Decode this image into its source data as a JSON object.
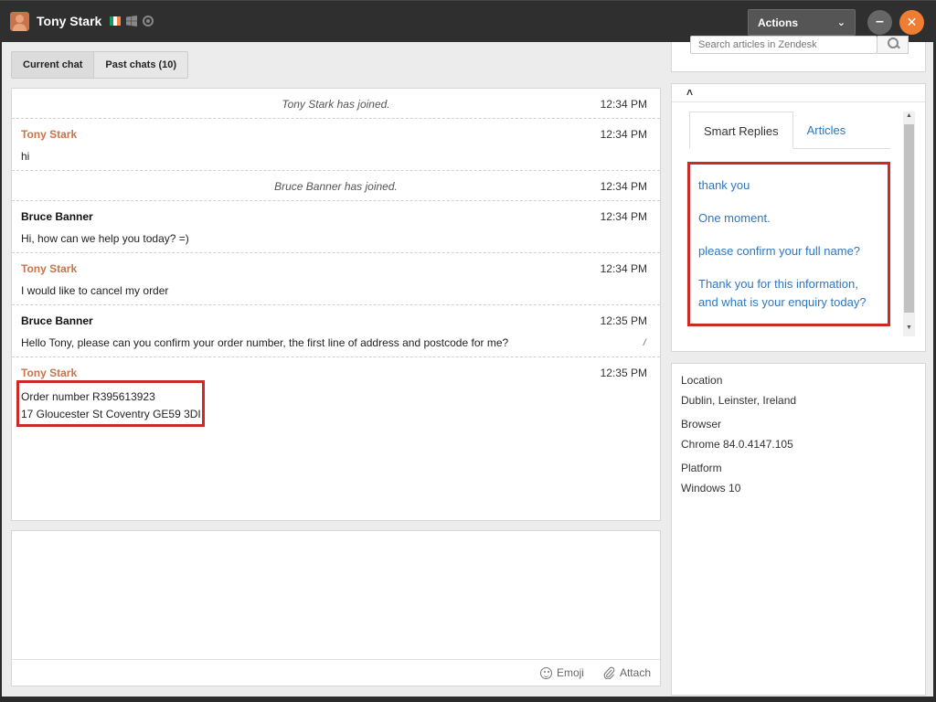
{
  "titlebar": {
    "visitor_name": "Tony Stark",
    "actions_label": "Actions",
    "minimize_label": "–",
    "close_label": "✕"
  },
  "tabs": {
    "current": "Current chat",
    "past": "Past chats (10)"
  },
  "chat": {
    "entries": [
      {
        "type": "system",
        "text": "Tony Stark has joined.",
        "time": "12:34 PM"
      },
      {
        "type": "visitor",
        "sender": "Tony Stark",
        "text": "hi",
        "time": "12:34 PM"
      },
      {
        "type": "system",
        "text": "Bruce Banner has joined.",
        "time": "12:34 PM"
      },
      {
        "type": "agent",
        "sender": "Bruce Banner",
        "text": "Hi, how can we help you today? =)",
        "time": "12:34 PM"
      },
      {
        "type": "visitor",
        "sender": "Tony Stark",
        "text": "I would like to cancel my order",
        "time": "12:34 PM"
      },
      {
        "type": "agent",
        "sender": "Bruce Banner",
        "text": "Hello Tony, please can you confirm your order number, the first line of address and postcode for me?",
        "time": "12:35 PM"
      },
      {
        "type": "visitor",
        "sender": "Tony Stark",
        "line1": "Order number R395613923",
        "line2": "17 Gloucester St Coventry GE59 3DI",
        "time": "12:35 PM"
      }
    ]
  },
  "composer": {
    "emoji_label": "Emoji",
    "attach_label": "Attach"
  },
  "sidebar": {
    "search_placeholder": "Search articles in Zendesk",
    "reply_tabs": [
      "Smart Replies",
      "Articles"
    ],
    "smart_replies": [
      "thank you",
      "One moment.",
      "please confirm your full name?",
      "Thank you for this information, and what is your enquiry today?"
    ],
    "info": {
      "location_label": "Location",
      "location_value": "Dublin, Leinster, Ireland",
      "browser_label": "Browser",
      "browser_value": "Chrome 84.0.4147.105",
      "platform_label": "Platform",
      "platform_value": "Windows 10"
    }
  },
  "colors": {
    "accent_orange": "#ef7d34",
    "visitor_name": "#c8744a",
    "link_blue": "#2f77c0",
    "highlight_red": "#cc2b25"
  }
}
